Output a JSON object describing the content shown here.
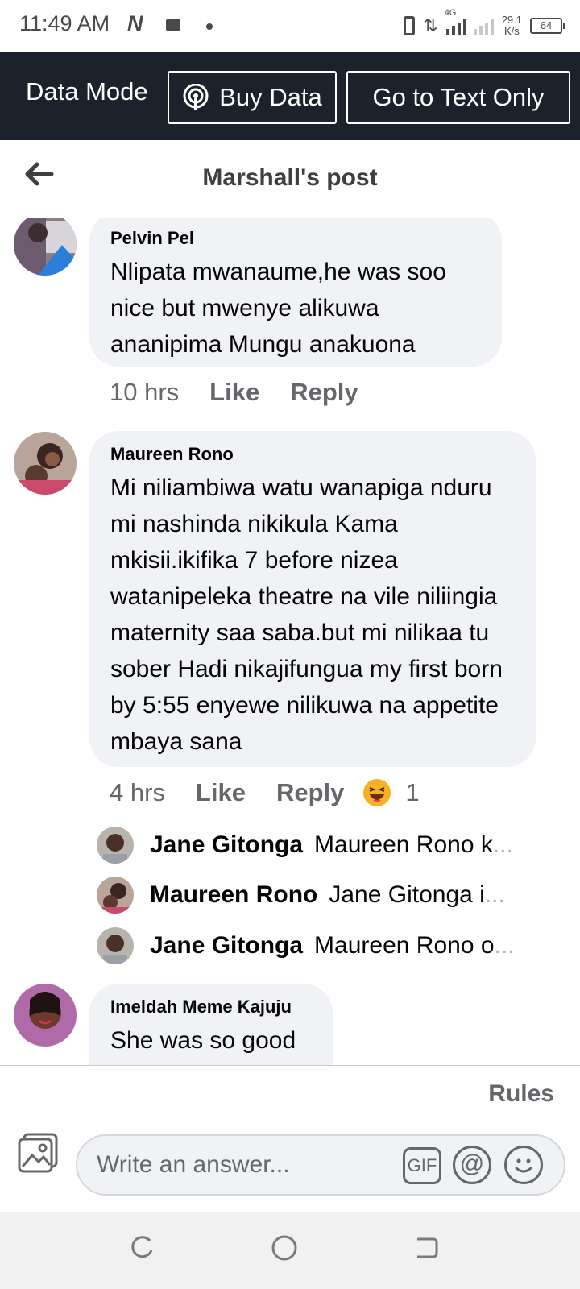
{
  "status_bar": {
    "time": "11:49 AM",
    "n_icon": "N",
    "network": "4G",
    "speed_value": "29.1",
    "speed_unit": "K/s",
    "battery": "64"
  },
  "data_mode": {
    "label": "Data Mode",
    "buy_data": "Buy Data",
    "text_only": "Go to Text Only"
  },
  "header": {
    "title": "Marshall's post"
  },
  "comments": [
    {
      "name": "Pelvin Pel",
      "text": "Nlipata mwanaume,he was soo nice but mwenye alikuwa ananipima Mungu anakuona",
      "time": "10 hrs",
      "like": "Like",
      "reply": "Reply"
    },
    {
      "name": "Maureen Rono",
      "text": "Mi niliambiwa watu wanapiga nduru mi nashinda nikikula Kama mkisii.ikifika 7 before nizea watanipeleka theatre na vile niliingia maternity saa saba.but mi nilikaa tu sober Hadi nikajifungua my first born by 5:55 enyewe nilikuwa na appetite mbaya sana",
      "time": "4 hrs",
      "like": "Like",
      "reply": "Reply",
      "reaction_count": "1",
      "replies": [
        {
          "name": "Jane Gitonga",
          "text": "Maureen Rono k",
          "more": "..."
        },
        {
          "name": "Maureen Rono",
          "text": "Jane Gitonga i",
          "more": "..."
        },
        {
          "name": "Jane Gitonga",
          "text": "Maureen Rono o",
          "more": "..."
        }
      ]
    },
    {
      "name": "Imeldah Meme Kajuju",
      "text": "She was so good"
    }
  ],
  "footer": {
    "rules": "Rules",
    "placeholder": "Write an answer...",
    "gif": "GIF",
    "at": "@"
  },
  "colors": {
    "data_bar": "#1c222b",
    "bubble": "#f0f2f5",
    "secondary_text": "#65676b"
  }
}
